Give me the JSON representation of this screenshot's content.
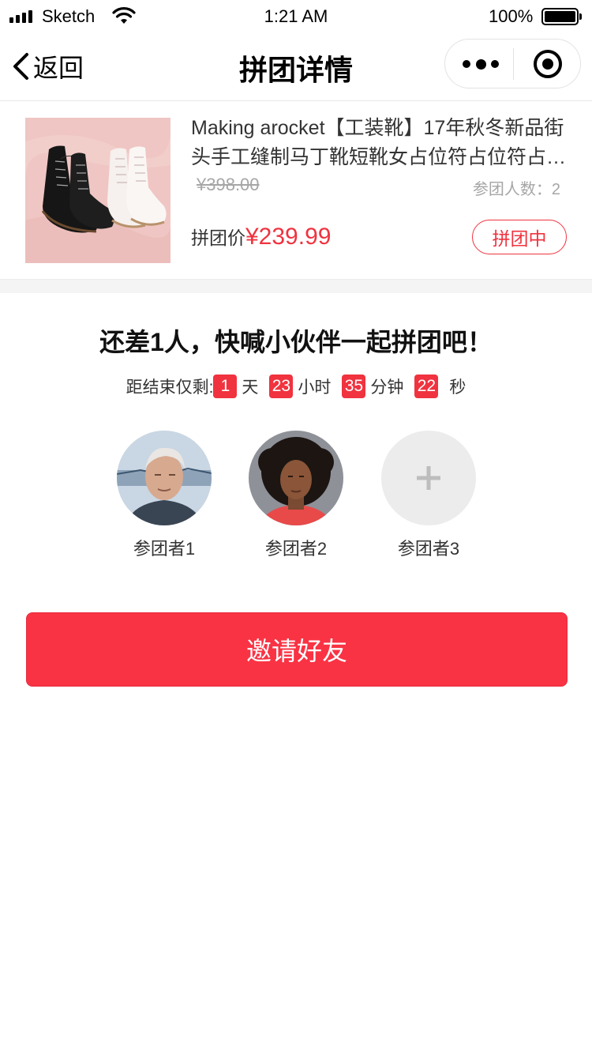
{
  "status_bar": {
    "carrier": "Sketch",
    "time": "1:21 AM",
    "battery": "100%"
  },
  "nav": {
    "back_label": "返回",
    "title": "拼团详情"
  },
  "product": {
    "title": "Making arocket【工装靴】17年秋冬新品街头手工缝制马丁靴短靴女占位符占位符占位符",
    "original_price": "¥398.00",
    "participants": "参团人数：2",
    "group_price_label": "拼团价",
    "group_price": "¥239.99",
    "status": "拼团中"
  },
  "invite": {
    "headline": "还差1人，快喊小伙伴一起拼团吧！",
    "countdown": {
      "label": "距结束仅剩:",
      "days": "1",
      "days_unit": "天",
      "hours": "23",
      "hours_unit": "小时",
      "minutes": "35",
      "minutes_unit": "分钟",
      "seconds": "22",
      "seconds_unit": "秒"
    },
    "members": [
      {
        "name": "参团者1"
      },
      {
        "name": "参团者2"
      },
      {
        "name": "参团者3"
      }
    ],
    "button_label": "邀请好友"
  },
  "colors": {
    "accent": "#f0333f",
    "button": "#f93344"
  }
}
